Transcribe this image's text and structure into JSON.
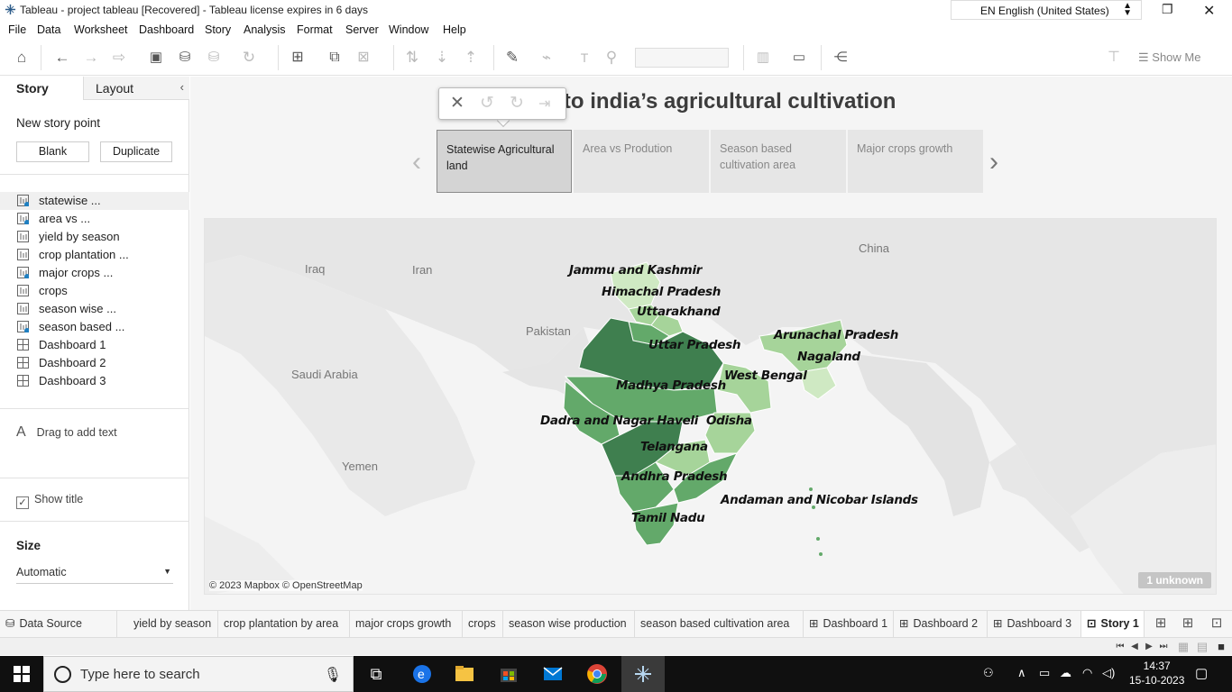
{
  "window": {
    "title": "Tableau - project tableau [Recovered] - Tableau license expires in 6 days",
    "language": "EN English (United States)"
  },
  "menu": [
    "File",
    "Data",
    "Worksheet",
    "Dashboard",
    "Story",
    "Analysis",
    "Format",
    "Server",
    "Window",
    "Help"
  ],
  "toolbar": {
    "show_me": "Show Me"
  },
  "left_panel": {
    "tab_story": "Story",
    "tab_layout": "Layout",
    "new_story_point": "New story point",
    "blank": "Blank",
    "duplicate": "Duplicate",
    "sheets": [
      {
        "label": "statewise ...",
        "kind": "sheet",
        "used": true
      },
      {
        "label": "area vs ...",
        "kind": "sheet",
        "used": true
      },
      {
        "label": "yield by season",
        "kind": "sheet",
        "used": false
      },
      {
        "label": "crop plantation ...",
        "kind": "sheet",
        "used": false
      },
      {
        "label": "major crops ...",
        "kind": "sheet",
        "used": true
      },
      {
        "label": "crops",
        "kind": "sheet",
        "used": false
      },
      {
        "label": "season wise ...",
        "kind": "sheet",
        "used": false
      },
      {
        "label": "season based ...",
        "kind": "sheet",
        "used": true
      },
      {
        "label": "Dashboard 1",
        "kind": "dashboard",
        "used": false
      },
      {
        "label": "Dashboard 2",
        "kind": "dashboard",
        "used": false
      },
      {
        "label": "Dashboard 3",
        "kind": "dashboard",
        "used": false
      }
    ],
    "drag_text": "Drag to add text",
    "show_title": "Show title",
    "size_label": "Size",
    "size_value": "Automatic"
  },
  "story": {
    "title": "s into india’s agricultural cultivation",
    "points": [
      {
        "label": "Statewise Agricultural land",
        "selected": true
      },
      {
        "label": "Area vs Prodution",
        "selected": false
      },
      {
        "label": "Season based cultivation area",
        "selected": false
      },
      {
        "label": "Major crops growth",
        "selected": false
      }
    ]
  },
  "map": {
    "state_labels": [
      "Jammu and Kashmir",
      "Himachal Pradesh",
      "Uttarakhand",
      "Uttar Pradesh",
      "Arunachal Pradesh",
      "Nagaland",
      "West Bengal",
      "Madhya Pradesh",
      "Dadra and Nagar Haveli",
      "Odisha",
      "Telangana",
      "Andhra Pradesh",
      "Andaman and Nicobar Islands",
      "Tamil Nadu"
    ],
    "country_labels": [
      "China",
      "Iraq",
      "Iran",
      "Pakistan",
      "Saudi Arabia",
      "Yemen"
    ],
    "attribution": "© 2023 Mapbox © OpenStreetMap",
    "unknown": "1 unknown",
    "colors": {
      "dark": "#3f7f4f",
      "mid": "#63a96a",
      "light": "#a6d49a",
      "pale": "#cfe9c3",
      "land": "#e8e8e8",
      "sea": "#f4f4f4"
    }
  },
  "sheet_tabs": [
    {
      "label": "Data Source",
      "icon": "database-icon",
      "active": false
    },
    {
      "label": "yield by season",
      "icon": "",
      "active": false
    },
    {
      "label": "crop plantation by area",
      "icon": "",
      "active": false
    },
    {
      "label": "major crops growth",
      "icon": "",
      "active": false
    },
    {
      "label": "crops",
      "icon": "",
      "active": false
    },
    {
      "label": "season wise production",
      "icon": "",
      "active": false
    },
    {
      "label": "season based cultivation area",
      "icon": "",
      "active": false
    },
    {
      "label": "Dashboard 1",
      "icon": "dashboard-icon",
      "active": false
    },
    {
      "label": "Dashboard 2",
      "icon": "dashboard-icon",
      "active": false
    },
    {
      "label": "Dashboard 3",
      "icon": "dashboard-icon",
      "active": false
    },
    {
      "label": "Story 1",
      "icon": "story-icon",
      "active": true
    }
  ],
  "taskbar": {
    "search_placeholder": "Type here to search",
    "time": "14:37",
    "date": "15-10-2023"
  }
}
